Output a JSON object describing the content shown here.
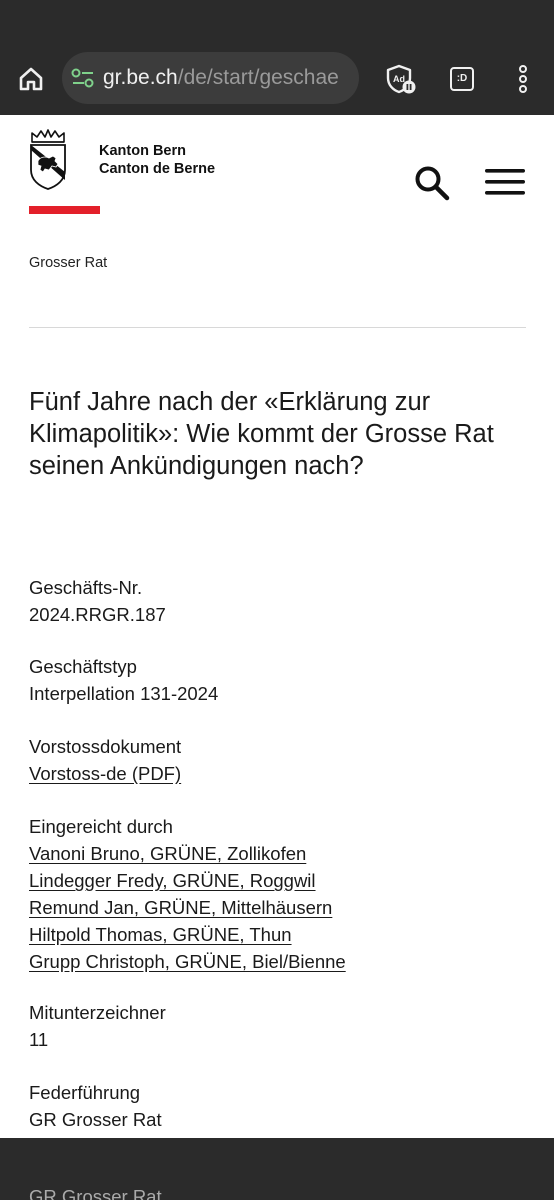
{
  "browser": {
    "url_host": "gr.be.ch",
    "url_path": "/de/start/geschae",
    "tabs_label": ":D"
  },
  "header": {
    "brand_line1": "Kanton Bern",
    "brand_line2": "Canton de Berne",
    "accent_color": "#e3202a"
  },
  "breadcrumb": "Grosser Rat",
  "title": "Fünf Jahre nach der «Erklärung zur Klimapolitik»: Wie kommt der Grosse Rat seinen Ankündigungen nach?",
  "fields": {
    "geschaeftsnr": {
      "label": "Geschäfts-Nr.",
      "value": "2024.RRGR.187"
    },
    "geschaeftstyp": {
      "label": "Geschäftstyp",
      "value": "Interpellation 131-2024"
    },
    "vorstossdokument": {
      "label": "Vorstossdokument",
      "link": "Vorstoss-de (PDF)"
    },
    "eingereicht": {
      "label": "Eingereicht durch",
      "people": [
        "Vanoni Bruno, GRÜNE, Zollikofen",
        "Lindegger Fredy, GRÜNE, Roggwil",
        "Remund Jan, GRÜNE, Mittelhäusern",
        "Hiltpold Thomas, GRÜNE, Thun",
        "Grupp Christoph, GRÜNE, Biel/Bienne"
      ]
    },
    "mitunterzeichner": {
      "label": "Mitunterzeichner",
      "value": "11"
    },
    "federfuehrung": {
      "label": "Federführung",
      "value": "GR Grosser Rat"
    }
  },
  "peek_text": "GR Grosser Rat"
}
